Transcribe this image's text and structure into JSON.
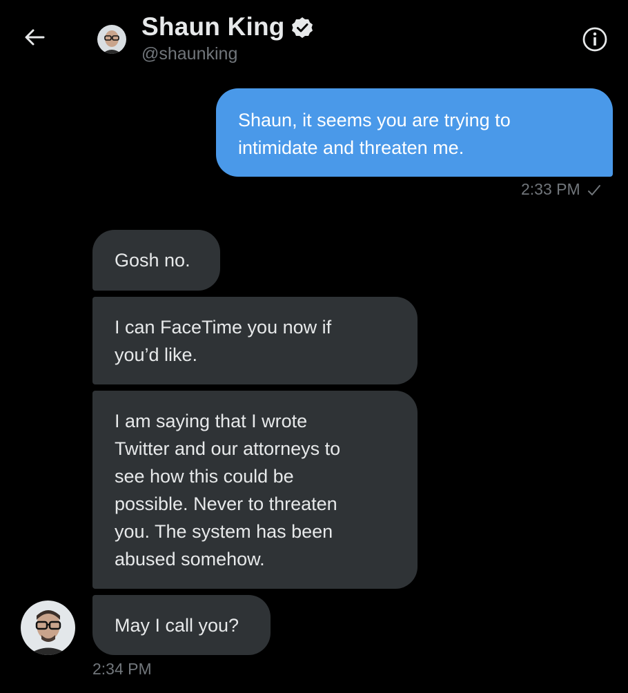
{
  "header": {
    "name": "Shaun King",
    "handle": "@shaunking",
    "icons": {
      "back": "arrow-left-icon",
      "verified": "verified-badge-icon",
      "info": "info-icon"
    }
  },
  "messages": [
    {
      "direction": "outgoing",
      "text": "Shaun, it seems you are trying to\nintimidate and threaten me.",
      "time": "2:33 PM",
      "status_icon": "sent-check-icon"
    },
    {
      "direction": "incoming",
      "text": "Gosh no."
    },
    {
      "direction": "incoming",
      "text": "I can FaceTime you now if\nyou’d like."
    },
    {
      "direction": "incoming",
      "text": "I am saying that I wrote\nTwitter and our attorneys to\nsee how this could be\npossible. Never to threaten\nyou. The system has been\nabused somehow."
    },
    {
      "direction": "incoming",
      "text": "May I call you?",
      "time": "2:34 PM"
    }
  ],
  "colors": {
    "background": "#000000",
    "outgoing_bubble": "#4a99e9",
    "incoming_bubble": "#2f3336",
    "secondary_text": "#71767b"
  }
}
